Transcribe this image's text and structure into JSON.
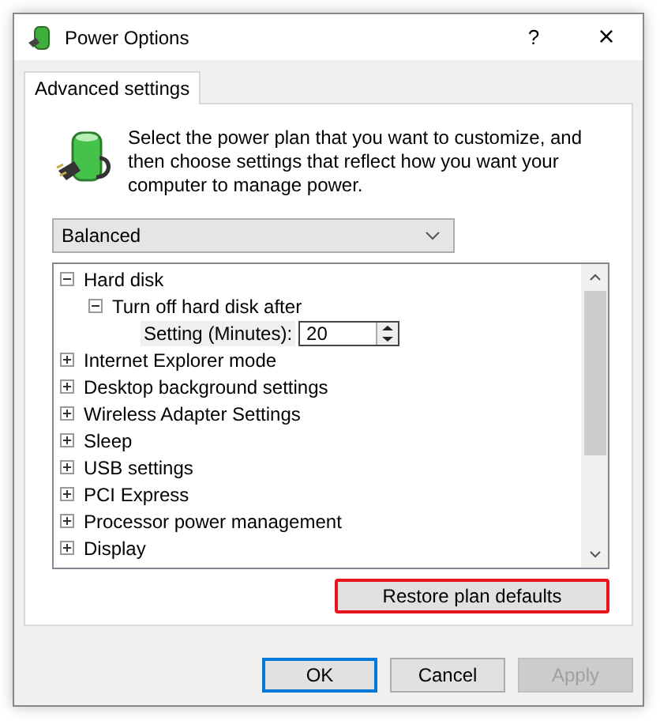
{
  "window": {
    "title": "Power Options",
    "help": "?",
    "close": "×"
  },
  "tabs": [
    {
      "label": "Advanced settings",
      "selected": true
    }
  ],
  "description": "Select the power plan that you want to customize, and then choose settings that reflect how you want your computer to manage power.",
  "plan_select": {
    "value": "Balanced"
  },
  "settings_tree": [
    {
      "label": "Hard disk",
      "expanded": true,
      "children": [
        {
          "label": "Turn off hard disk after",
          "expanded": true,
          "children": [
            {
              "kind": "spin",
              "label": "Setting (Minutes):",
              "value": "20"
            }
          ]
        }
      ]
    },
    {
      "label": "Internet Explorer mode",
      "expanded": false
    },
    {
      "label": "Desktop background settings",
      "expanded": false
    },
    {
      "label": "Wireless Adapter Settings",
      "expanded": false
    },
    {
      "label": "Sleep",
      "expanded": false
    },
    {
      "label": "USB settings",
      "expanded": false
    },
    {
      "label": "PCI Express",
      "expanded": false
    },
    {
      "label": "Processor power management",
      "expanded": false
    },
    {
      "label": "Display",
      "expanded": false
    }
  ],
  "restore_button": {
    "label": "Restore plan defaults",
    "highlighted": true
  },
  "buttons": [
    {
      "label": "OK",
      "default": true,
      "disabled": false
    },
    {
      "label": "Cancel",
      "default": false,
      "disabled": false
    },
    {
      "label": "Apply",
      "default": false,
      "disabled": true
    }
  ]
}
